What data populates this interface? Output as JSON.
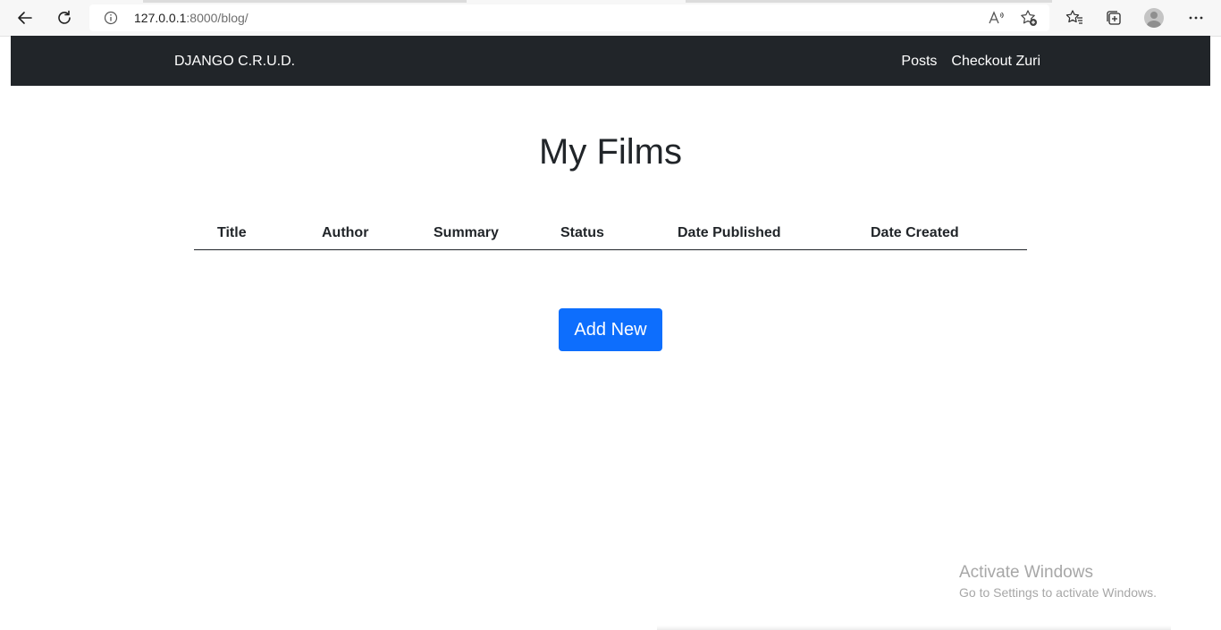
{
  "browser": {
    "url_host": "127.0.0.1",
    "url_path": ":8000/blog/"
  },
  "navbar": {
    "brand": "DJANGO C.R.U.D.",
    "links": [
      "Posts",
      "Checkout Zuri"
    ],
    "background": "#212529"
  },
  "main": {
    "title": "My Films",
    "table": {
      "columns": [
        "Title",
        "Author",
        "Summary",
        "Status",
        "Date Published",
        "Date Created"
      ],
      "rows": []
    },
    "add_button_label": "Add New",
    "accent_color": "#0d6efd"
  },
  "watermark": {
    "title": "Activate Windows",
    "subtitle": "Go to Settings to activate Windows."
  }
}
